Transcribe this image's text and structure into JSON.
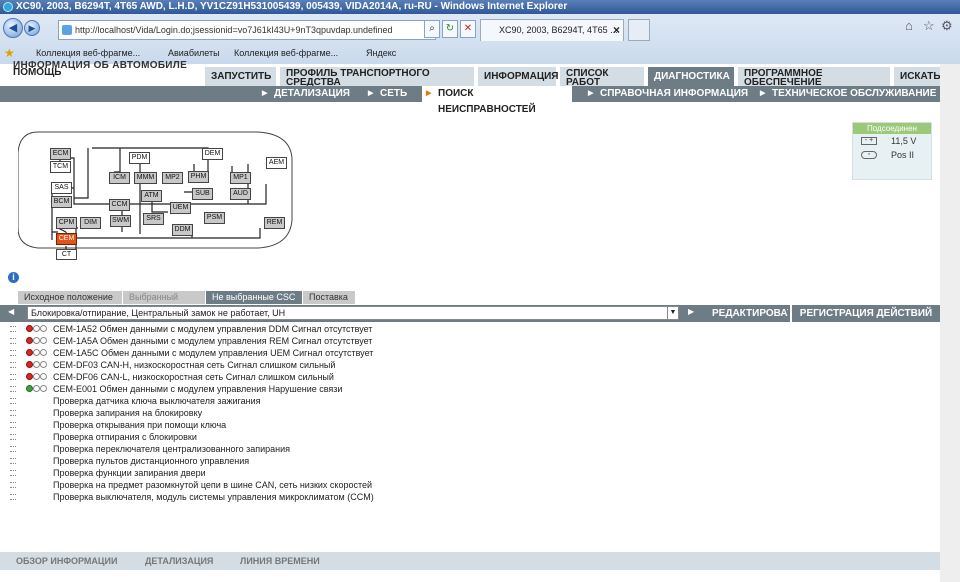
{
  "window": {
    "title": "XC90, 2003, B6294T, 4T65 AWD, L.H.D, YV1CZ91H531005439, 005439, VIDA2014A, ru-RU - Windows Internet Explorer"
  },
  "browser": {
    "address": "http://localhost/Vida/Login.do;jsessionid=vo7J61kI43U+9nT3qpuvdap.undefined",
    "tab_title": "XC90, 2003, B6294T, 4T65 ...",
    "favorites": [
      "Коллекция веб-фрагме...",
      "Авиабилеты",
      "Коллекция веб-фрагме...",
      "Яндекс"
    ]
  },
  "app": {
    "brand_cut": "ИНФОРМАЦИЯ ОБ АВТОМОБИЛЕ",
    "help": "ПОМОЩЬ",
    "main_tabs": [
      {
        "label": "ЗАПУСТИТЬ",
        "active": false
      },
      {
        "label": "ПРОФИЛЬ ТРАНСПОРТНОГО СРЕДСТВА",
        "active": false
      },
      {
        "label": "ИНФОРМАЦИЯ",
        "active": false
      },
      {
        "label": "СПИСОК РАБОТ",
        "active": false
      },
      {
        "label": "ДИАГНОСТИКА",
        "active": true
      },
      {
        "label": "ПРОГРАММНОЕ ОБЕСПЕЧЕНИЕ",
        "active": false
      },
      {
        "label": "ИСКАТЬ",
        "active": false
      }
    ],
    "sub_tabs": [
      "ДЕТАЛИЗАЦИЯ",
      "СЕТЬ",
      "ПОИСК НЕИСПРАВНОСТЕЙ",
      "СПРАВОЧНАЯ ИНФОРМАЦИЯ",
      "ТЕХНИЧЕСКОЕ ОБСЛУЖИВАНИЕ"
    ],
    "sub_selected": "ПОИСК НЕИСПРАВНОСТЕЙ",
    "modules": [
      "ECM",
      "TCM",
      "PDM",
      "DEM",
      "AEM",
      "ICM",
      "MMM",
      "MP2",
      "PHM",
      "MP1",
      "SAS",
      "BCM",
      "ATM",
      "SUB",
      "AUD",
      "CCM",
      "UEM",
      "CPM",
      "DIM",
      "SWM",
      "SRS",
      "DDM",
      "PSM",
      "REM",
      "CEM",
      "CT"
    ],
    "highlighted_module": "CEM",
    "connection": {
      "header": "Подсоединен",
      "voltage": "11,5 V",
      "ignition": "Pos II"
    },
    "csc_tabs": [
      {
        "label": "Исходное положение",
        "state": "normal"
      },
      {
        "label": "Выбранный CSC",
        "state": "dim"
      },
      {
        "label": "Не выбранные CSC",
        "state": "selected"
      },
      {
        "label": "Поставка",
        "state": "normal"
      }
    ],
    "filter_value": "Блокировка/отпирание, Центральный замок не работает, UH",
    "edit_label": "РЕДАКТИРОВАТЬ",
    "register_label": "РЕГИСТРАЦИЯ ДЕЙСТВИЙ",
    "dtc_items": [
      {
        "text": "CEM-1A52 Обмен данными с модулем управления DDM Сигнал отсутствует",
        "status": "red"
      },
      {
        "text": "CEM-1A5A Обмен данными с модулем управления REM Сигнал отсутствует",
        "status": "red"
      },
      {
        "text": "CEM-1A5C Обмен данными с модулем управления UEM Сигнал отсутствует",
        "status": "red"
      },
      {
        "text": "CEM-DF03 CAN-H, низкоскоростная сеть Сигнал слишком сильный",
        "status": "red"
      },
      {
        "text": "CEM-DF06 CAN-L, низкоскоростная сеть Сигнал слишком сильный",
        "status": "red"
      },
      {
        "text": "CEM-E001 Обмен данными с модулем управления Нарушение связи",
        "status": "green"
      }
    ],
    "check_items": [
      "Проверка датчика ключа выключателя зажигания",
      "Проверка запирания на блокировку",
      "Проверка открывания при помощи ключа",
      "Проверка отпирания с блокировки",
      "Проверка переключателя централизованного запирания",
      "Проверка пультов дистанционного управления",
      "Проверка функции запирания двери",
      "Проверка на предмет разомкнутой цепи в шине CAN, сеть низких скоростей",
      "Проверка выключателя, модуль системы управления микроклиматом (CCM)"
    ],
    "bottom_tabs": [
      "ОБЗОР ИНФОРМАЦИИ",
      "ДЕТАЛИЗАЦИЯ",
      "ЛИНИЯ ВРЕМЕНИ"
    ]
  }
}
